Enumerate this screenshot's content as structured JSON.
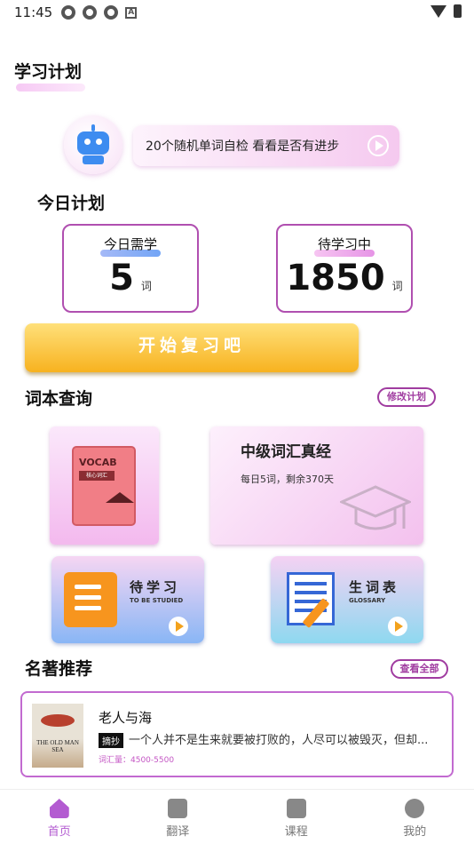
{
  "status_bar": {
    "time": "11:45",
    "status_glyph": "A"
  },
  "plan_section": {
    "title": "学习计划"
  },
  "self_test": {
    "label": "20个随机单词自检 看看是否有进步"
  },
  "today": {
    "title": "今日计划",
    "need_label": "今日需学",
    "need_value": "5",
    "need_unit": "词",
    "pending_label": "待学习中",
    "pending_value": "1850",
    "pending_unit": "词"
  },
  "start_button": "开始复习吧",
  "wordbook": {
    "title": "词本查询",
    "edit_label": "修改计划",
    "book_cover_title": "VOCAB",
    "book_cover_sub": "核心词汇",
    "course_name": "中级词汇真经",
    "course_progress": "每日5词，剩余370天"
  },
  "tiles": {
    "to_study_cn": "待学习",
    "to_study_en": "TO BE STUDIED",
    "glossary_cn": "生词表",
    "glossary_en": "GLOSSARY"
  },
  "famous": {
    "title": "名著推荐",
    "view_all": "查看全部",
    "book_title": "老人与海",
    "excerpt_tag": "摘抄",
    "excerpt": "一个人并不是生来就要被打败的，人尽可以被毁灭，但却...",
    "vocab": "词汇量：4500-5500",
    "cover_text": "THE OLD MAN SEA"
  },
  "nav": {
    "home": "首页",
    "translate": "翻译",
    "course": "课程",
    "mine": "我的"
  },
  "colors": {
    "accent": "#b35bd1",
    "button_yellow": "#f7b21f",
    "card_border": "#b04fb0"
  }
}
